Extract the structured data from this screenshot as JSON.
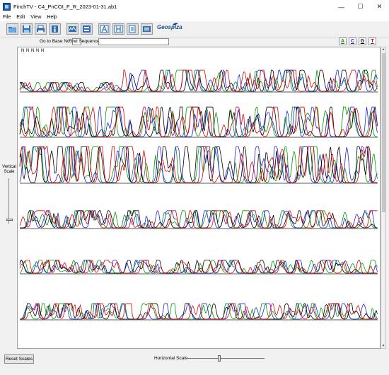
{
  "window": {
    "title": "FinchTV - C4_PnCOI_F_R_2023-01-31.ab1",
    "minimize": "—",
    "maximize": "☐",
    "close": "✕"
  },
  "menu": [
    "File",
    "Edit",
    "View",
    "Help"
  ],
  "toolbar": {
    "buttons": [
      "open-icon",
      "save-icon",
      "print-icon",
      "info-icon",
      "sequence-view-icon",
      "chromatogram-icon",
      "fit-a-icon",
      "fit-h-icon",
      "copy-icon",
      "export-icon"
    ],
    "brand": "Geospiza"
  },
  "nav": {
    "goto_label": "Go to Base No.",
    "goto_value": "",
    "find_label": "Find Sequence",
    "find_value": ""
  },
  "bases": [
    "A",
    "C",
    "G",
    "T"
  ],
  "colors": {
    "A": "#009900",
    "C": "#2020e0",
    "G": "#000000",
    "T": "#e00000"
  },
  "sequence_header": "N N N N N",
  "chromatogram": {
    "rows": 6,
    "baseline_color": "#777777"
  },
  "vertical_scale": {
    "label_line1": "Vertical",
    "label_line2": "Scale"
  },
  "bottom": {
    "reset_label": "Reset Scales",
    "horizontal_scale_label": "Horizontal Scale"
  }
}
